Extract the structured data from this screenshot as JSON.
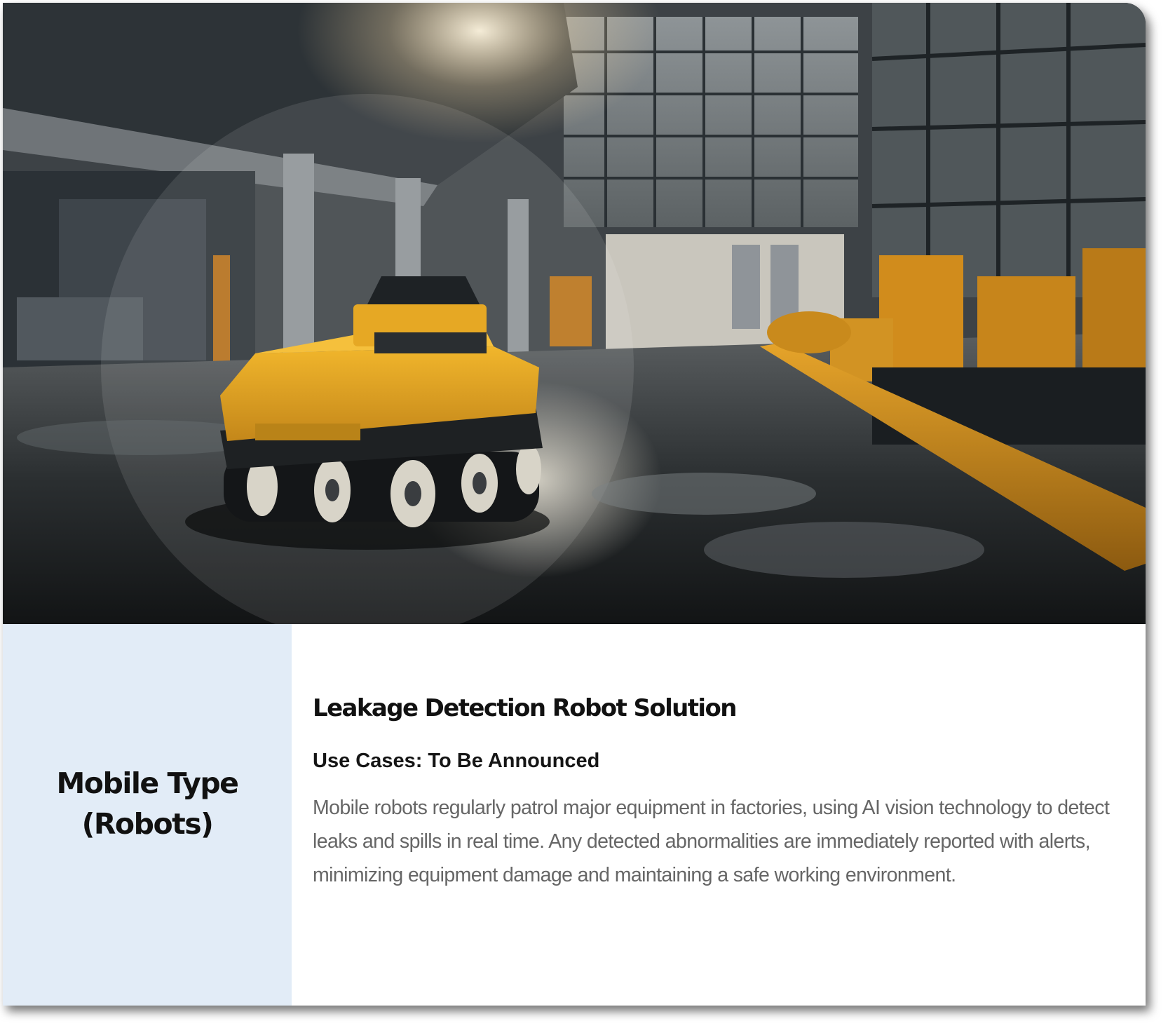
{
  "hero": {
    "image_description_icon": "factory-robot-photo"
  },
  "category": {
    "title": "Mobile Type\n(Robots)"
  },
  "solution": {
    "title": "Leakage Detection Robot Solution",
    "use_cases": "Use Cases: To Be Announced",
    "description": "Mobile robots regularly patrol major equipment in factories, using AI vision technology to detect leaks and spills in real time. Any detected abnormalities are immediately reported with alerts, minimizing equipment damage and maintaining a safe working environment."
  },
  "colors": {
    "panel_bg": "#e2ecf7",
    "robot_yellow": "#e0a21e",
    "pipe_orange": "#c98a1c"
  }
}
